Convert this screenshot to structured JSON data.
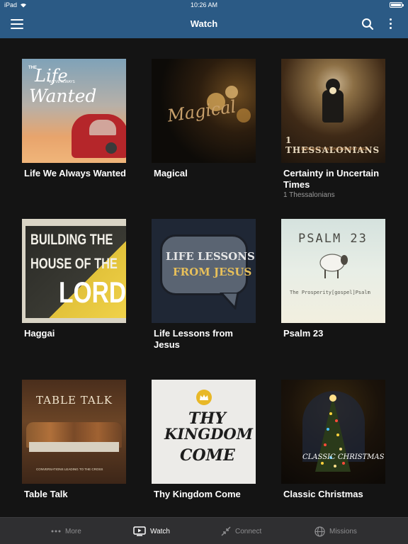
{
  "status": {
    "device": "iPad",
    "time": "10:26 AM"
  },
  "nav": {
    "title": "Watch"
  },
  "series": [
    {
      "title": "Life We Always Wanted",
      "subtitle": "",
      "art": [
        "THE",
        "Life",
        "WE'VE ALWAYS",
        "Wanted"
      ]
    },
    {
      "title": "Magical",
      "subtitle": "",
      "art": [
        "Magical"
      ]
    },
    {
      "title": "Certainty in Uncertain Times",
      "subtitle": "1 Thessalonians",
      "art": [
        "1 THESSALONIANS",
        "CERTAINTY IN UNCERTAIN TIMES"
      ]
    },
    {
      "title": "Haggai",
      "subtitle": "",
      "art": [
        "BUILDING THE",
        "HOUSE OF THE",
        "LORD"
      ]
    },
    {
      "title": "Life Lessons from Jesus",
      "subtitle": "",
      "art": [
        "LIFE LESSONS",
        "FROM JESUS"
      ]
    },
    {
      "title": "Psalm 23",
      "subtitle": "",
      "art": [
        "PSALM 23",
        "The Prosperity[gospel]Psalm"
      ]
    },
    {
      "title": "Table Talk",
      "subtitle": "",
      "art": [
        "TABLE TALK",
        "CONVERSATIONS LEADING TO THE CROSS"
      ]
    },
    {
      "title": "Thy Kingdom Come",
      "subtitle": "",
      "art": [
        "THY",
        "KINGDOM",
        "COME"
      ]
    },
    {
      "title": "Classic Christmas",
      "subtitle": "",
      "art": [
        "CLASSIC CHRISTMAS"
      ]
    }
  ],
  "tabs": [
    {
      "label": "More",
      "icon": "more-dots-icon"
    },
    {
      "label": "Watch",
      "icon": "tv-play-icon",
      "active": true
    },
    {
      "label": "Connect",
      "icon": "connect-arrows-icon"
    },
    {
      "label": "Missions",
      "icon": "globe-icon"
    }
  ],
  "colors": {
    "nav": "#2b5a85",
    "background": "#141414",
    "tabbar": "#2f2f31"
  }
}
